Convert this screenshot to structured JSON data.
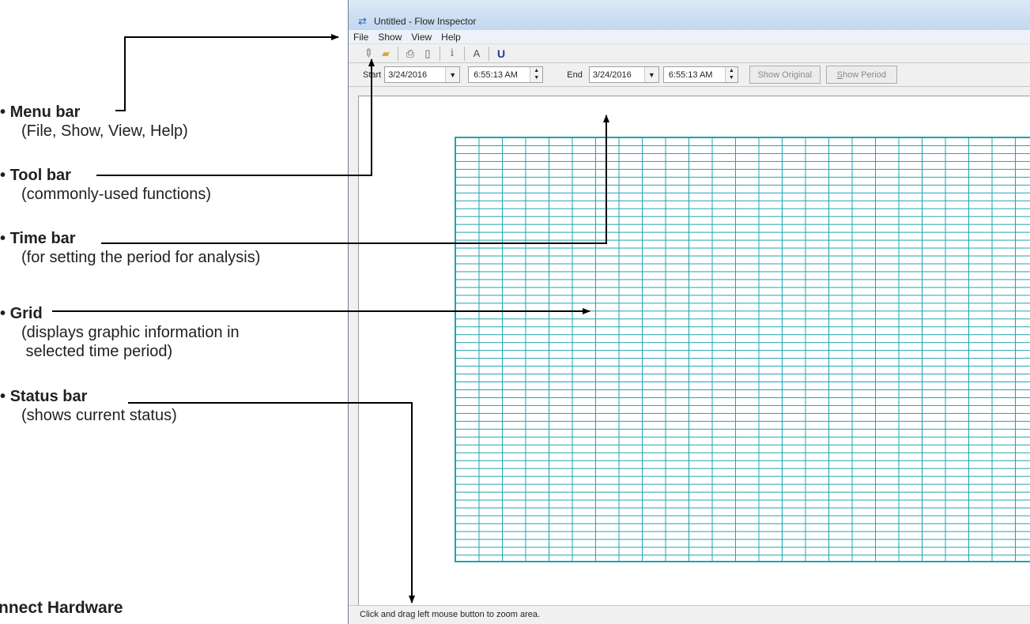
{
  "annotations": {
    "menu_bar": {
      "title": "Menu bar",
      "desc": "(File, Show, View, Help)"
    },
    "tool_bar": {
      "title": "Tool bar",
      "desc": "(commonly-used functions)"
    },
    "time_bar": {
      "title": "Time bar",
      "desc": "(for setting the period for analysis)"
    },
    "grid": {
      "title": "Grid",
      "desc1": "(displays graphic information in",
      "desc2": " selected time period)"
    },
    "status_bar": {
      "title": "Status bar",
      "desc": "(shows current status)"
    }
  },
  "section_heading": "Connect Hardware",
  "window": {
    "title": "Untitled - Flow Inspector",
    "menu": [
      "File",
      "Show",
      "View",
      "Help"
    ],
    "toolbar_icons": [
      "pen-icon",
      "open-folder-icon",
      "print-icon",
      "print-preview-icon",
      "info-icon",
      "a-icon",
      "u-icon"
    ],
    "toolbar": {
      "info_glyph": "i",
      "a_glyph": "A",
      "u_glyph": "U"
    },
    "timebar": {
      "start_label": "Start",
      "start_date": "3/24/2016",
      "start_time": "6:55:13 AM",
      "end_label": "End",
      "end_date": "3/24/2016",
      "end_time": "6:55:13 AM",
      "show_original": "Show Original",
      "show_period_underline": "S",
      "show_period_rest": "how Period"
    },
    "status_text": "Click and drag left mouse button to zoom area.",
    "grid_color": "#1fa3b0"
  }
}
